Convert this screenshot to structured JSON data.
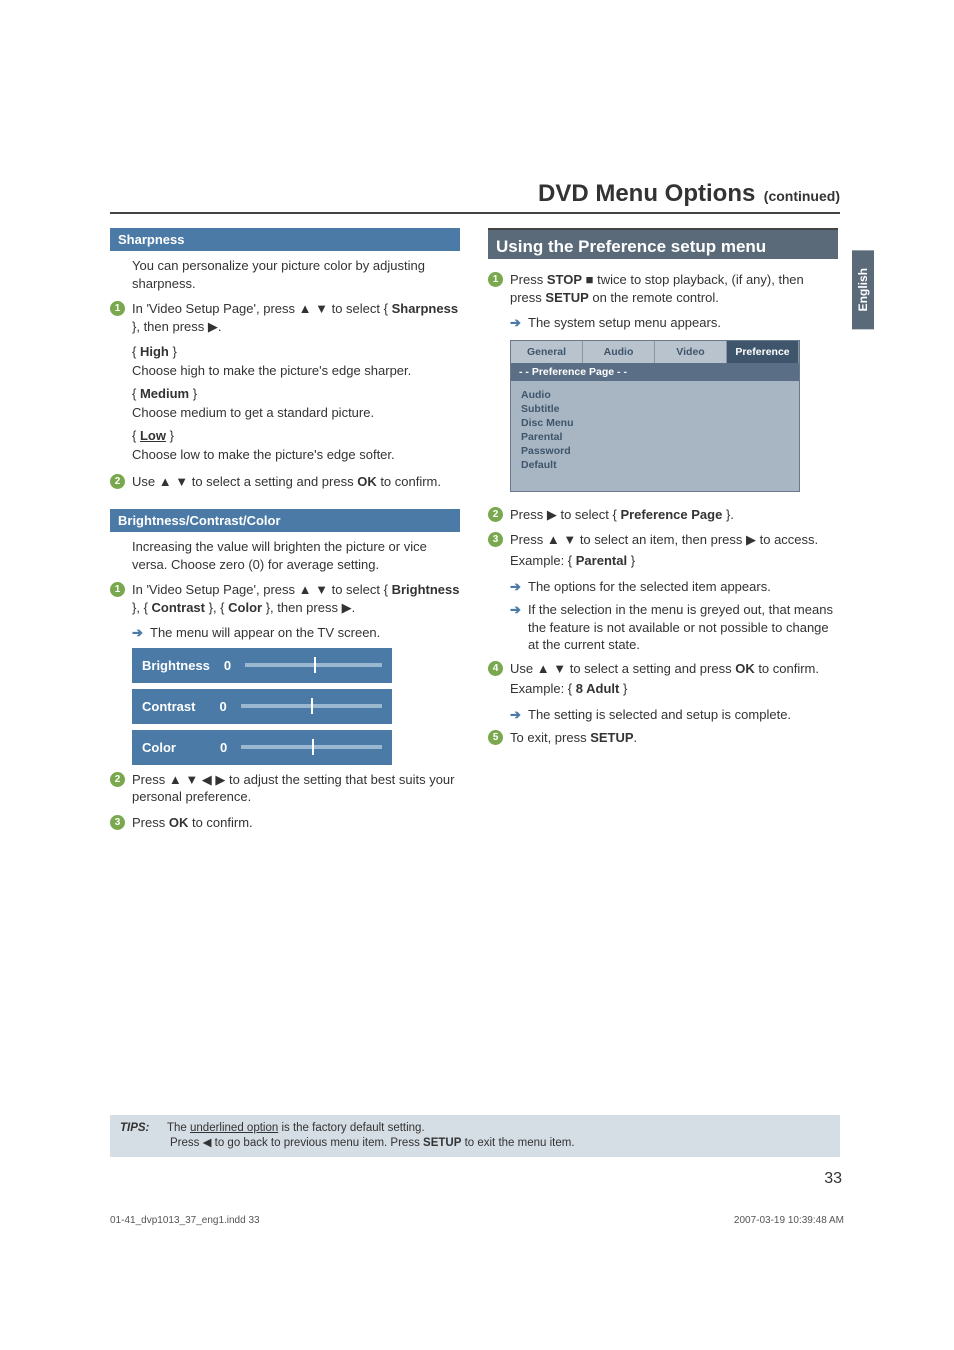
{
  "header": {
    "title": "DVD Menu Options",
    "subtitle": "(continued)"
  },
  "side_tab": "English",
  "left": {
    "sharpness": {
      "bar": "Sharpness",
      "intro": "You can personalize your picture color by adjusting sharpness.",
      "step1_a": "In 'Video Setup Page', press ",
      "step1_b": " to select { ",
      "step1_bold": "Sharpness",
      "step1_c": " }, then press ",
      "step1_d": ".",
      "options": {
        "high_title": "High",
        "high_desc": "Choose high to make the picture's edge sharper.",
        "medium_title": "Medium",
        "medium_desc": "Choose medium to get a standard picture.",
        "low_title": "Low",
        "low_desc": "Choose low to make the picture's edge softer."
      },
      "step2_a": "Use ",
      "step2_b": " to select a setting and press ",
      "step2_bold": "OK",
      "step2_c": " to confirm."
    },
    "bcc": {
      "bar": "Brightness/Contrast/Color",
      "intro": "Increasing the value will brighten the picture or vice versa. Choose zero (0) for average setting.",
      "step1_a": "In 'Video Setup Page', press ",
      "step1_b": " to select { ",
      "step1_bold1": "Brightness",
      "step1_c": " }, { ",
      "step1_bold2": "Contrast",
      "step1_d": " }, { ",
      "step1_bold3": "Color",
      "step1_e": " }, then press ",
      "step1_f": ".",
      "arrow1": "The menu will appear on the TV screen.",
      "sliders": {
        "brightness_label": "Brightness",
        "brightness_val": "0",
        "contrast_label": "Contrast",
        "contrast_val": "0",
        "color_label": "Color",
        "color_val": "0"
      },
      "step2_a": "Press ",
      "step2_b": " to adjust the setting that best suits your personal preference.",
      "step3_a": "Press ",
      "step3_bold": "OK",
      "step3_b": " to confirm."
    }
  },
  "right": {
    "section_title": "Using the Preference setup menu",
    "step1_a": "Press ",
    "step1_bold1": "STOP",
    "step1_b": "  twice to stop playback, (if any), then press ",
    "step1_bold2": "SETUP",
    "step1_c": " on the remote control.",
    "arrow1": "The system setup menu appears.",
    "osd": {
      "tabs": [
        "General",
        "Audio",
        "Video",
        "Preference"
      ],
      "page_label": "- -   Preference Page   - -",
      "items": [
        "Audio",
        "Subtitle",
        "Disc Menu",
        "Parental",
        "Password",
        "Default"
      ]
    },
    "step2_a": "Press ",
    "step2_b": " to select { ",
    "step2_bold": "Preference Page",
    "step2_c": " }.",
    "step3_a": "Press ",
    "step3_b": " to select an item, then press ",
    "step3_c": " to access.",
    "step3_ex_a": "Example: { ",
    "step3_ex_bold": "Parental",
    "step3_ex_b": " }",
    "arrow3a": "The options for the selected item appears.",
    "arrow3b": "If the selection in the menu is greyed out, that means the feature is not available or not possible to change at the current state.",
    "step4_a": "Use ",
    "step4_b": " to select a setting and press ",
    "step4_bold": "OK",
    "step4_c": " to confirm.",
    "step4_ex_a": "Example: { ",
    "step4_ex_bold": "8 Adult",
    "step4_ex_b": " }",
    "arrow4": "The setting is selected and setup is complete.",
    "step5_a": "To exit, press ",
    "step5_bold": "SETUP",
    "step5_b": "."
  },
  "tips": {
    "label": "TIPS:",
    "line1_a": "The ",
    "line1_u": "underlined option",
    "line1_b": " is the factory default setting.",
    "line2_a": "Press ",
    "line2_b": " to go back to previous menu item. Press ",
    "line2_bold": "SETUP",
    "line2_c": " to exit the menu item."
  },
  "page_number": "33",
  "footer": {
    "left": "01-41_dvp1013_37_eng1.indd   33",
    "right": "2007-03-19   10:39:48 AM"
  },
  "glyph": {
    "up": "▲",
    "down": "▼",
    "left": "◀",
    "right": "▶",
    "stop": "■",
    "udlr": "▲ ▼ ◀ ▶",
    "ud": "▲ ▼"
  }
}
